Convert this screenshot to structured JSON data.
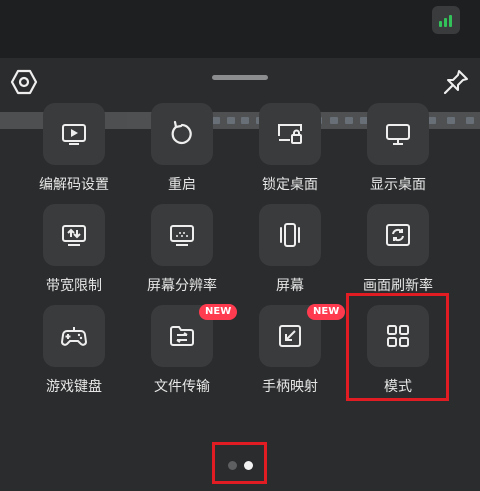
{
  "header": {
    "handle": "drag-handle"
  },
  "menu": {
    "items": [
      {
        "label": "编解码设置",
        "icon": "codec-settings-icon"
      },
      {
        "label": "重启",
        "icon": "restart-icon"
      },
      {
        "label": "锁定桌面",
        "icon": "lock-desktop-icon"
      },
      {
        "label": "显示桌面",
        "icon": "show-desktop-icon"
      },
      {
        "label": "带宽限制",
        "icon": "bandwidth-limit-icon"
      },
      {
        "label": "屏幕分辨率",
        "icon": "screen-resolution-icon"
      },
      {
        "label": "屏幕",
        "icon": "screen-icon"
      },
      {
        "label": "画面刷新率",
        "icon": "refresh-rate-icon"
      },
      {
        "label": "游戏键盘",
        "icon": "gamepad-icon"
      },
      {
        "label": "文件传输",
        "icon": "file-transfer-icon",
        "badge": "NEW"
      },
      {
        "label": "手柄映射",
        "icon": "controller-mapping-icon",
        "badge": "NEW"
      },
      {
        "label": "模式",
        "icon": "grid-mode-icon"
      }
    ]
  },
  "pager": {
    "total_pages": 2,
    "current_page": 2
  },
  "colors": {
    "accent_badge": "#ff3b50",
    "signal": "#33c25a",
    "highlight": "#e21c23"
  }
}
